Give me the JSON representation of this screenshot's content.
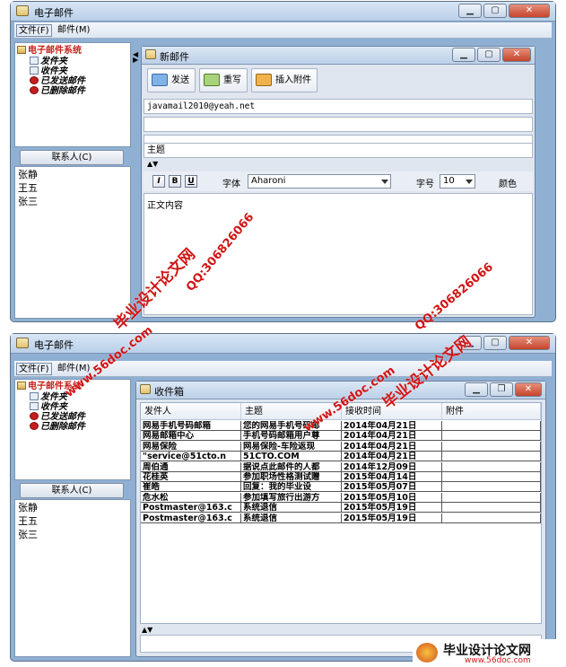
{
  "top_window": {
    "title": "电子邮件",
    "menus": [
      "文件(F)",
      "邮件(M)"
    ],
    "tree": {
      "root": "电子邮件系统",
      "items": [
        "发件夹",
        "收件夹",
        "已发送邮件",
        "已删除邮件"
      ]
    },
    "contacts_button": "联系人(C)",
    "contacts": [
      "张静",
      "王五",
      "张三"
    ],
    "compose": {
      "title": "新邮件",
      "toolbar": [
        "发送",
        "重写",
        "插入附件"
      ],
      "to_value": "javamail2010@yeah.net",
      "subject_label": "主题",
      "format_buttons": [
        "I",
        "B",
        "U"
      ],
      "font_label": "字体",
      "font_value": "Aharoni",
      "size_label": "字号",
      "size_value": "10",
      "color_label": "颜色",
      "body_value": "正文内容"
    }
  },
  "bottom_window": {
    "title": "电子邮件",
    "menus": [
      "文件(F)",
      "邮件(M)"
    ],
    "tree": {
      "root": "电子邮件系统",
      "items": [
        "发件夹",
        "收件夹",
        "已发送邮件",
        "已删除邮件"
      ]
    },
    "contacts_button": "联系人(C)",
    "contacts": [
      "张静",
      "王五",
      "张三"
    ],
    "inbox": {
      "title": "收件箱",
      "columns": [
        "发件人",
        "主题",
        "接收时间",
        "附件"
      ],
      "rows": [
        [
          "网易手机号码邮箱",
          "您的网易手机号码邮",
          "2014年04月21日",
          ""
        ],
        [
          "网易邮箱中心",
          "手机号码邮箱用户尊",
          "2014年04月21日",
          ""
        ],
        [
          "网易保险",
          "网易保险-车险返现",
          "2014年04月21日",
          ""
        ],
        [
          "\"service@51cto.n",
          "51CTO.COM",
          "2014年04月21日",
          ""
        ],
        [
          "周伯通",
          "据说点此邮件的人都",
          "2014年12月09日",
          ""
        ],
        [
          "花桂英",
          "参加职场性格测试赠",
          "2015年04月14日",
          ""
        ],
        [
          "崔皓",
          "回复：我的毕业设",
          "2015年05月07日",
          ""
        ],
        [
          "危水松",
          "参加填写旅行出游方",
          "2015年05月10日",
          ""
        ],
        [
          "Postmaster@163.c",
          "系统退信",
          "2015年05月19日",
          ""
        ],
        [
          "Postmaster@163.c",
          "系统退信",
          "2015年05月19日",
          ""
        ]
      ]
    }
  },
  "watermarks": [
    "毕业设计论文网",
    "QQ:306826066",
    "www.56doc.com",
    "www.56doc.com",
    "毕业设计论文网",
    "QQ:306826066"
  ],
  "footer": {
    "brand": "毕业设计论文网",
    "url": "www.56doc.com"
  }
}
